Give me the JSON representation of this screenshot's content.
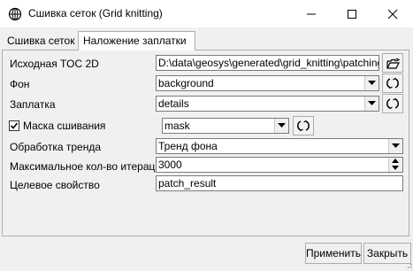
{
  "window": {
    "title": "Сшивка сеток (Grid knitting)"
  },
  "tabs": [
    {
      "label": "Сшивка сеток",
      "active": false
    },
    {
      "label": "Наложение заплатки",
      "active": true
    }
  ],
  "form": {
    "source_toc": {
      "label": "Исходная TOC 2D",
      "value": "D:\\data\\geosys\\generated\\grid_knitting\\patching\\pa"
    },
    "background": {
      "label": "Фон",
      "value": "background"
    },
    "patch": {
      "label": "Заплатка",
      "value": "details"
    },
    "mask": {
      "label": "Маска сшивания",
      "checked": true,
      "value": "mask"
    },
    "trend": {
      "label": "Обработка тренда",
      "value": "Тренд фона"
    },
    "max_iter": {
      "label": "Максимальное кол-во итераций",
      "value": "3000"
    },
    "target": {
      "label": "Целевое свойство",
      "value": "patch_result"
    }
  },
  "buttons": {
    "apply": "Применить",
    "close": "Закрыть"
  },
  "icons": {
    "app": "globe-icon",
    "browse": "folder-open-icon",
    "refresh": "refresh-icon",
    "dropdown": "chevron-down-icon",
    "spin_up": "spin-up-icon",
    "spin_down": "spin-down-icon"
  },
  "colors": {
    "window_bg": "#f0f0f0",
    "field_border": "#7a7a7a",
    "panel_border": "#adadad"
  }
}
